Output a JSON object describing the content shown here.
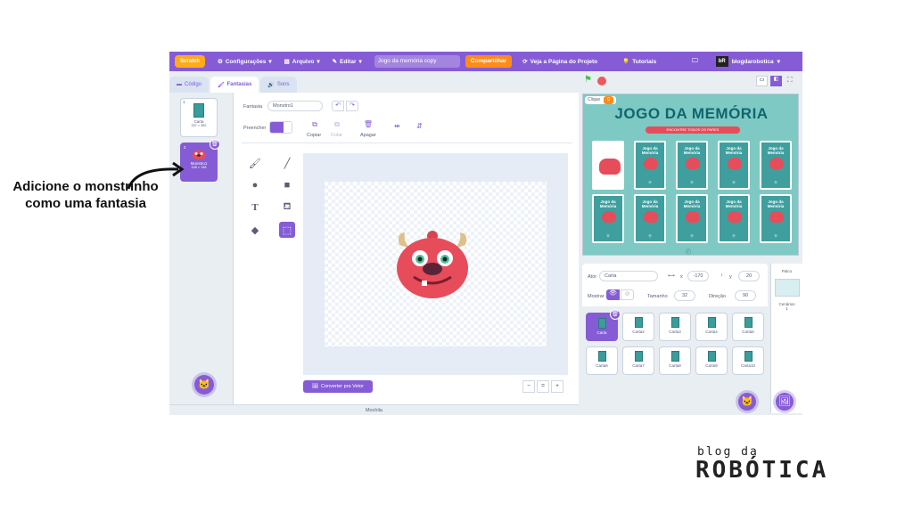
{
  "menubar": {
    "logo": "Scratch",
    "items": [
      "Configurações",
      "Arquivo",
      "Editar"
    ],
    "project_title": "Jogo da memória copy",
    "share": "Compartilhar",
    "see_project": "Veja a Página do Projeto",
    "tutorials": "Tutoriais",
    "username": "blogdarobotica",
    "avatar_text": "bR"
  },
  "tabs": [
    "Código",
    "Fantasias",
    "Sons"
  ],
  "costumes": [
    {
      "num": "1",
      "name": "Carta",
      "size": "257 × 382"
    },
    {
      "num": "2",
      "name": "Monstro1",
      "size": "165 × 158"
    }
  ],
  "paint": {
    "costume_label": "Fantasia",
    "costume_name": "Monstro1",
    "fill_label": "Preencher",
    "actions": [
      "Copiar",
      "Colar",
      "Apagar"
    ],
    "convert_btn": "Converter pra Vetor",
    "zoom": [
      "−",
      "=",
      "+"
    ]
  },
  "backpack": "Mochila",
  "stage": {
    "variable_label": "Clique",
    "variable_value": "0",
    "title": "JOGO DA MEMÓRIA",
    "subtitle": "ENCONTRE TODOS OS PARES",
    "card_title": "Jogo da Memória",
    "card_footer": "Ⓡ",
    "footer_logo": "ⓡ"
  },
  "sprite_info": {
    "sprite_label": "Ator",
    "sprite_name": "Carta",
    "x_label": "x",
    "x_value": "-170",
    "y_label": "y",
    "y_value": "20",
    "show_label": "Mostrar",
    "size_label": "Tamanho",
    "size_value": "32",
    "direction_label": "Direção",
    "direction_value": "90"
  },
  "sprites": [
    "Carta",
    "Carta2",
    "Carta3",
    "Carta4",
    "Carta5",
    "Carta6",
    "Carta7",
    "Carta8",
    "Carta9",
    "Carta10"
  ],
  "stage_pane": {
    "label": "Palco",
    "backdrops_label": "Cenários",
    "backdrops_count": "1"
  },
  "annotation": "Adicione o monstrinho como uma fantasia",
  "brand": {
    "top": "blog da",
    "main": "ROBÓTICA"
  },
  "colors": {
    "accent": "#855cd6",
    "orange": "#ff8c1a",
    "stage": "#7ec9c3",
    "monster": "#e74c5a"
  }
}
